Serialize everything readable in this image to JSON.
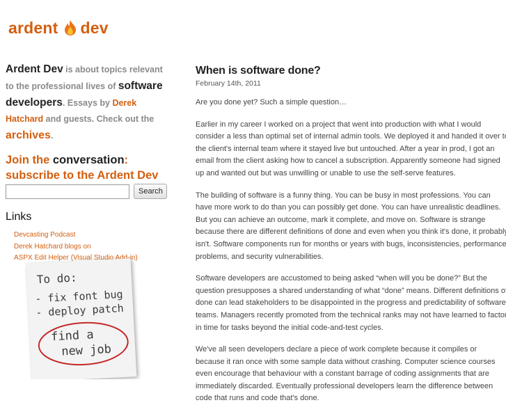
{
  "site": {
    "logo_word1": "ardent",
    "logo_word2": "dev",
    "accent_color": "#d35f0f"
  },
  "sidebar": {
    "intro": {
      "brand": "Ardent Dev",
      "text1": " is about topics relevant to the professional lives of ",
      "highlight": "software developers",
      "text2": ". Essays by ",
      "author": "Derek Hatchard",
      "text3": " and guests. Check out the ",
      "archives": "archives",
      "text4": "."
    },
    "join": {
      "part1": "Join the ",
      "part2": "conversation",
      "part3": ": subscribe to the Ardent Dev List",
      "part4": "."
    },
    "search": {
      "value": "",
      "button_label": "Search"
    },
    "links_heading": "Links",
    "links": [
      {
        "label": "Devcasting Podcast"
      },
      {
        "label": "Derek Hatchard blogs on"
      },
      {
        "label": "ASPX Edit Helper (Visual Studio Add-in)"
      }
    ],
    "note": {
      "line1": "To do:",
      "line2": "- fix font bug",
      "line3": "- deploy patch",
      "line4": "find a",
      "line5": "new job"
    }
  },
  "post": {
    "title": "When is software done?",
    "date": "February 14th, 2011",
    "lead": "Are you done yet? Such a simple question…",
    "p1": [
      "Earlier in my career I worked on a project that went into production with what I would",
      "consider a less than optimal set of internal admin tools. We deployed it and handed it over to",
      "the client's internal team where it stayed live but untouched. After a year in prod, I got an",
      "email from the client asking how to cancel a subscription. Apparently someone had signed",
      "up and wanted out but was unwilling or unable to use the self-serve features."
    ],
    "p2": [
      "The building of software is a funny thing. You can be busy in most professions. You can",
      "have more work to do than you can possibly get done. You can have unrealistic deadlines.",
      "But you can achieve an outcome, mark it complete, and move on. Software is strange",
      "because there are different definitions of done and even when you think it's done, it probably",
      "isn't. Software components run for months or years with bugs, inconsistencies, performance",
      "problems, and security vulnerabilities."
    ],
    "p3": [
      "Software developers are accustomed to being asked “when will you be done?” But the",
      "question presupposes a shared understanding of what “done” means. Different definitions of",
      "done can lead stakeholders to be disappointed in the progress and predictability of software",
      "teams. Managers recently promoted from the technical ranks may not have learned to factor",
      "in time for tasks beyond the initial code-and-test cycles."
    ],
    "p4": [
      "We've all seen developers declare a piece of work complete because it compiles or",
      "because it ran once with some sample data without crashing. Computer science courses",
      "even encourage that behaviour with a constant barrage of coding assignments that are",
      "immediately discarded. Eventually professional developers learn the difference between",
      "code that runs and code that's done."
    ]
  }
}
